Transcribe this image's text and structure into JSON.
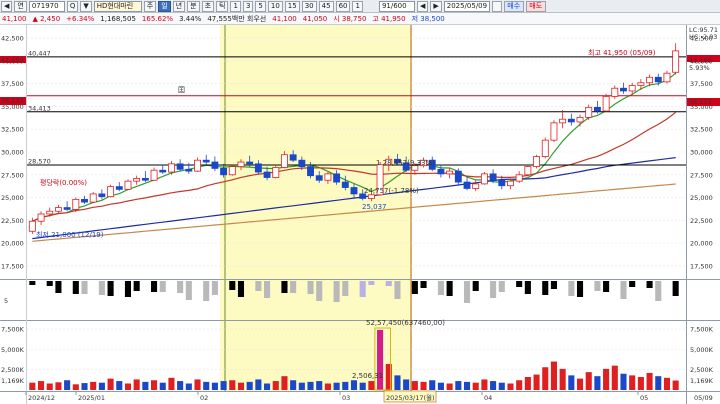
{
  "toolbar": {
    "items": [
      "◀",
      "연",
      "071970",
      "Q",
      "▼",
      "HD현대마린",
      "주",
      "일",
      "년",
      "분",
      "초",
      "틱"
    ],
    "ticks": [
      "1",
      "3",
      "5",
      "10",
      "15",
      "30",
      "45",
      "60",
      "1"
    ],
    "count": "91/600",
    "nav_prev": "◀",
    "nav_next": "▶",
    "date": "2025/05/09",
    "buy": "매수",
    "sell": "매도"
  },
  "info": {
    "price": "41,100",
    "change": "▲ 2,450",
    "change_pct": "+6.34%",
    "volume": "1,168,505",
    "vol_ratio": "165.62%",
    "turnover": "3.44%",
    "amount": "47,555백만 회우선",
    "open_label": "41,100",
    "high_label": "41,050",
    "open": "시 38,750",
    "high": "고 41,950",
    "low": "저 38,500"
  },
  "chart_data": {
    "type": "candlestick",
    "title": "",
    "price_axis": {
      "ticks": [
        "42,500",
        "40,000",
        "37,500",
        "35,000",
        "32,500",
        "30,000",
        "27,500",
        "25,000",
        "22,500",
        "20,000",
        "17,500"
      ],
      "ylim": [
        16500,
        43500
      ],
      "right_labels": [
        "LC:95.71",
        "HC:-2.03",
        "41,100",
        "5.93%",
        "35,172"
      ]
    },
    "horizontal_levels": [
      {
        "label": "40,447",
        "value": 40447,
        "color": "#000000"
      },
      {
        "label": "36,172",
        "value": 36172,
        "color": "#d0021b"
      },
      {
        "label": "34,413",
        "value": 34413,
        "color": "#000000"
      },
      {
        "label": "28,570",
        "value": 28570,
        "color": "#000000"
      }
    ],
    "annotations": {
      "high": "최고 41,950 (05/09)",
      "low": "최저 21,000 (12/19)",
      "note1": "평당락(0.00%)",
      "note2": "1 28,457(9.33%)",
      "note3": "24,757(-1.78%)",
      "note4": "25,037",
      "vol_peak": "52,57,450(637460,00)",
      "vol_low": "2,506,31"
    },
    "x_labels": [
      "2024/12",
      "2025/01",
      "02",
      "03",
      "04",
      "05",
      "05/09"
    ],
    "highlight_period": {
      "start": "2025/02",
      "end": "2025/03/17",
      "label": "2025/03/17(월)"
    },
    "candles": [
      [
        21300,
        22800,
        21000,
        22400
      ],
      [
        22400,
        23500,
        22000,
        23200
      ],
      [
        23200,
        23900,
        22900,
        23500
      ],
      [
        23500,
        24200,
        23300,
        23900
      ],
      [
        23900,
        24600,
        23500,
        23700
      ],
      [
        23700,
        25000,
        23400,
        24800
      ],
      [
        24800,
        25200,
        24300,
        24500
      ],
      [
        24500,
        25600,
        24400,
        25400
      ],
      [
        25400,
        25900,
        24800,
        25100
      ],
      [
        25100,
        26400,
        25000,
        26200
      ],
      [
        26200,
        26700,
        25700,
        25900
      ],
      [
        25900,
        27000,
        25800,
        26800
      ],
      [
        26800,
        27400,
        26400,
        27100
      ],
      [
        27100,
        27900,
        26700,
        26900
      ],
      [
        26900,
        28300,
        26800,
        28000
      ],
      [
        28000,
        28600,
        27600,
        27800
      ],
      [
        27800,
        29000,
        27500,
        28700
      ],
      [
        28700,
        29200,
        27900,
        28100
      ],
      [
        28100,
        28800,
        27600,
        27900
      ],
      [
        27900,
        29400,
        27800,
        29100
      ],
      [
        29100,
        29700,
        28600,
        28900
      ],
      [
        28900,
        29500,
        27900,
        28200
      ],
      [
        28200,
        28700,
        27200,
        27500
      ],
      [
        27500,
        28600,
        27400,
        28400
      ],
      [
        28400,
        29200,
        28000,
        28900
      ],
      [
        28900,
        29600,
        28400,
        28700
      ],
      [
        28700,
        29100,
        27600,
        27800
      ],
      [
        27800,
        28400,
        26900,
        27200
      ],
      [
        27200,
        28600,
        27100,
        28300
      ],
      [
        28300,
        30100,
        28200,
        29700
      ],
      [
        29700,
        30200,
        28900,
        29100
      ],
      [
        29100,
        29500,
        28000,
        28400
      ],
      [
        28400,
        28900,
        27100,
        27400
      ],
      [
        27400,
        27900,
        26600,
        26900
      ],
      [
        26900,
        27800,
        26500,
        27600
      ],
      [
        27600,
        28000,
        26400,
        26700
      ],
      [
        26700,
        27400,
        25800,
        26100
      ],
      [
        26100,
        26500,
        25000,
        25400
      ],
      [
        25400,
        25900,
        24700,
        24900
      ],
      [
        24900,
        25500,
        24600,
        25300
      ],
      [
        25300,
        28900,
        25200,
        28600
      ],
      [
        28600,
        29600,
        27900,
        29200
      ],
      [
        29200,
        29800,
        28600,
        28800
      ],
      [
        28800,
        29500,
        27800,
        28000
      ],
      [
        28000,
        28800,
        27500,
        28500
      ],
      [
        28500,
        29400,
        28300,
        29100
      ],
      [
        29100,
        29500,
        27900,
        28100
      ],
      [
        28100,
        28600,
        27200,
        27600
      ],
      [
        27600,
        28300,
        27100,
        27900
      ],
      [
        27900,
        28200,
        26400,
        26700
      ],
      [
        26700,
        27300,
        25800,
        26000
      ],
      [
        26000,
        26900,
        25700,
        26500
      ],
      [
        26500,
        27800,
        26400,
        27600
      ],
      [
        27600,
        28100,
        26600,
        26900
      ],
      [
        26900,
        27400,
        25900,
        26300
      ],
      [
        26300,
        27100,
        25900,
        26800
      ],
      [
        26800,
        27900,
        26600,
        27500
      ],
      [
        27500,
        28600,
        27300,
        28400
      ],
      [
        28400,
        29700,
        28200,
        29500
      ],
      [
        29500,
        31600,
        29300,
        31300
      ],
      [
        31300,
        33500,
        31100,
        33200
      ],
      [
        33200,
        34600,
        32600,
        33600
      ],
      [
        33600,
        34200,
        32900,
        33300
      ],
      [
        33300,
        34100,
        32800,
        33800
      ],
      [
        33800,
        35200,
        33500,
        34900
      ],
      [
        34900,
        35600,
        34200,
        34500
      ],
      [
        34500,
        36400,
        34400,
        36100
      ],
      [
        36100,
        37300,
        35800,
        37000
      ],
      [
        37000,
        37600,
        36400,
        36700
      ],
      [
        36700,
        37600,
        36300,
        37300
      ],
      [
        37300,
        38000,
        36800,
        37600
      ],
      [
        37600,
        38500,
        37200,
        38200
      ],
      [
        38200,
        38600,
        37300,
        37700
      ],
      [
        37700,
        38900,
        37500,
        38650
      ],
      [
        38750,
        41950,
        38500,
        41100
      ]
    ],
    "volume_axis": {
      "ticks": [
        "7,500K",
        "5,000K",
        "2,500K",
        "1,169K"
      ],
      "left_ticks": [
        "7,500K",
        "5,000K",
        "2,500K",
        "1,169K"
      ]
    },
    "volumes": [
      900,
      1100,
      800,
      950,
      1200,
      700,
      850,
      1000,
      900,
      1400,
      1100,
      800,
      1300,
      1000,
      1200,
      900,
      1500,
      1100,
      800,
      1300,
      1000,
      900,
      1100,
      1200,
      900,
      1000,
      1300,
      800,
      1100,
      1700,
      1200,
      900,
      1000,
      1100,
      800,
      900,
      1000,
      1200,
      900,
      1100,
      7400,
      3200,
      1800,
      1300,
      1100,
      1000,
      1200,
      900,
      800,
      1100,
      1000,
      900,
      1300,
      1100,
      900,
      800,
      1200,
      1600,
      1900,
      2800,
      3500,
      2600,
      1800,
      1400,
      2200,
      1700,
      2600,
      3000,
      2000,
      1800,
      1600,
      2100,
      1700,
      1500,
      1169
    ],
    "indicator_axis": {
      "ticks": [
        "5"
      ]
    }
  }
}
